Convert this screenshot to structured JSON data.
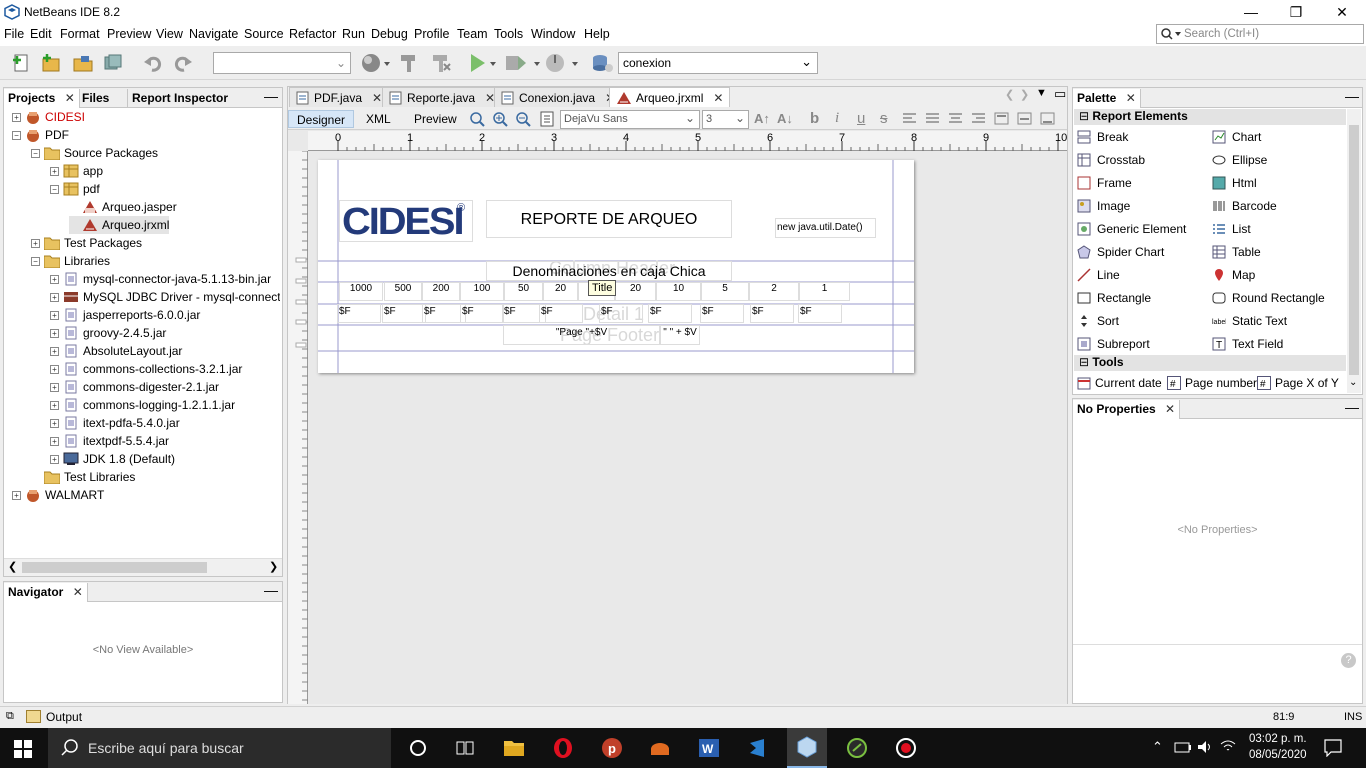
{
  "window": {
    "title": "NetBeans IDE 8.2",
    "min": "—",
    "restore": "❐",
    "close": "✕"
  },
  "menu": [
    "File",
    "Edit",
    "Format",
    "Preview",
    "View",
    "Navigate",
    "Source",
    "Refactor",
    "Run",
    "Debug",
    "Profile",
    "Team",
    "Tools",
    "Window",
    "Help"
  ],
  "search": {
    "placeholder": "Search (Ctrl+I)"
  },
  "toolbar": {
    "config_value": "",
    "connection_value": "conexion"
  },
  "projects_panel": {
    "tabs": [
      "Projects",
      "Files",
      "Report Inspector"
    ],
    "tree": [
      {
        "label": "CIDESI",
        "level": 0,
        "exp": "+",
        "icon": "project-icon",
        "red": true
      },
      {
        "label": "PDF",
        "level": 0,
        "exp": "-",
        "icon": "project-icon",
        "red": false
      },
      {
        "label": "Source Packages",
        "level": 1,
        "exp": "-",
        "icon": "folder-icon",
        "red": false
      },
      {
        "label": "app",
        "level": 2,
        "exp": "+",
        "icon": "package-icon",
        "red": false
      },
      {
        "label": "pdf",
        "level": 2,
        "exp": "-",
        "icon": "package-icon",
        "red": false
      },
      {
        "label": "Arqueo.jasper",
        "level": 3,
        "exp": "",
        "icon": "jasper-icon",
        "red": false
      },
      {
        "label": "Arqueo.jrxml",
        "level": 3,
        "exp": "",
        "icon": "jrxml-icon",
        "red": false
      },
      {
        "label": "Test Packages",
        "level": 1,
        "exp": "+",
        "icon": "folder-icon",
        "red": false
      },
      {
        "label": "Libraries",
        "level": 1,
        "exp": "-",
        "icon": "folder-icon",
        "red": false
      },
      {
        "label": "mysql-connector-java-5.1.13-bin.jar",
        "level": 2,
        "exp": "+",
        "icon": "jar-icon",
        "red": false
      },
      {
        "label": "MySQL JDBC Driver - mysql-connector-ja",
        "level": 2,
        "exp": "+",
        "icon": "driver-icon",
        "red": false
      },
      {
        "label": "jasperreports-6.0.0.jar",
        "level": 2,
        "exp": "+",
        "icon": "jar-icon",
        "red": false
      },
      {
        "label": "groovy-2.4.5.jar",
        "level": 2,
        "exp": "+",
        "icon": "jar-icon",
        "red": false
      },
      {
        "label": "AbsoluteLayout.jar",
        "level": 2,
        "exp": "+",
        "icon": "jar-icon",
        "red": false
      },
      {
        "label": "commons-collections-3.2.1.jar",
        "level": 2,
        "exp": "+",
        "icon": "jar-icon",
        "red": false
      },
      {
        "label": "commons-digester-2.1.jar",
        "level": 2,
        "exp": "+",
        "icon": "jar-icon",
        "red": false
      },
      {
        "label": "commons-logging-1.2.1.1.jar",
        "level": 2,
        "exp": "+",
        "icon": "jar-icon",
        "red": false
      },
      {
        "label": "itext-pdfa-5.4.0.jar",
        "level": 2,
        "exp": "+",
        "icon": "jar-icon",
        "red": false
      },
      {
        "label": "itextpdf-5.5.4.jar",
        "level": 2,
        "exp": "+",
        "icon": "jar-icon",
        "red": false
      },
      {
        "label": "JDK 1.8 (Default)",
        "level": 2,
        "exp": "+",
        "icon": "jdk-icon",
        "red": false
      },
      {
        "label": "Test Libraries",
        "level": 1,
        "exp": "",
        "icon": "folder-icon",
        "red": false
      },
      {
        "label": "WALMART",
        "level": 0,
        "exp": "+",
        "icon": "project-icon",
        "red": false
      }
    ]
  },
  "navigator": {
    "tab": "Navigator",
    "empty": "<No View Available>"
  },
  "editor": {
    "tabs": [
      {
        "label": "PDF.java",
        "icon": "java-icon",
        "active": false
      },
      {
        "label": "Reporte.java",
        "icon": "java-icon",
        "active": false
      },
      {
        "label": "Conexion.java",
        "icon": "java-icon",
        "active": false
      },
      {
        "label": "Arqueo.jrxml",
        "icon": "jrxml-icon",
        "active": true
      }
    ],
    "subtabs": [
      "Designer",
      "XML",
      "Preview"
    ],
    "font_value": "DejaVu Sans",
    "size_value": "3",
    "ruler": [
      "0",
      "1",
      "2",
      "3",
      "4",
      "5",
      "6",
      "7",
      "8",
      "9",
      "10"
    ]
  },
  "report": {
    "logo_text": "CIDESI",
    "logo_reg": "®",
    "title": "REPORTE DE ARQUEO",
    "date_expr": "new java.util.Date()",
    "subtitle": "Denominaciones en caja Chica",
    "tooltip": "Title",
    "denominations": [
      "1000",
      "500",
      "200",
      "100",
      "50",
      "20",
      "10",
      "20",
      "10",
      "5",
      "2",
      "1"
    ],
    "fields": [
      "$F",
      "$F",
      "$F",
      "$F",
      "$F",
      "$F",
      "$F",
      "$F",
      "$F",
      "$F",
      "$F"
    ],
    "band_labels": [
      "Column Header",
      "Detail 1",
      "Page Footer"
    ],
    "page_expr": "\"Page \"+$V",
    "page_expr2": "\" \" + $V"
  },
  "palette": {
    "tab": "Palette",
    "section1": "Report Elements",
    "items": [
      {
        "label": "Break",
        "icon": "break-icon"
      },
      {
        "label": "Chart",
        "icon": "chart-icon"
      },
      {
        "label": "Crosstab",
        "icon": "crosstab-icon"
      },
      {
        "label": "Ellipse",
        "icon": "ellipse-icon"
      },
      {
        "label": "Frame",
        "icon": "frame-icon"
      },
      {
        "label": "Html",
        "icon": "html-icon"
      },
      {
        "label": "Image",
        "icon": "image-icon"
      },
      {
        "label": "Barcode",
        "icon": "barcode-icon"
      },
      {
        "label": "Generic Element",
        "icon": "generic-icon"
      },
      {
        "label": "List",
        "icon": "list-icon"
      },
      {
        "label": "Spider Chart",
        "icon": "spider-icon"
      },
      {
        "label": "Table",
        "icon": "table-icon"
      },
      {
        "label": "Line",
        "icon": "line-icon"
      },
      {
        "label": "Map",
        "icon": "map-icon"
      },
      {
        "label": "Rectangle",
        "icon": "rectangle-icon"
      },
      {
        "label": "Round Rectangle",
        "icon": "round-rect-icon"
      },
      {
        "label": "Sort",
        "icon": "sort-icon"
      },
      {
        "label": "Static Text",
        "icon": "static-text-icon"
      },
      {
        "label": "Subreport",
        "icon": "subreport-icon"
      },
      {
        "label": "Text Field",
        "icon": "text-field-icon"
      }
    ],
    "section2": "Tools",
    "tools": [
      {
        "label": "Current date",
        "icon": "date-icon"
      },
      {
        "label": "Page number",
        "icon": "hash-icon"
      },
      {
        "label": "Page X of Y",
        "icon": "hash-icon"
      }
    ]
  },
  "properties": {
    "tab": "No Properties",
    "empty": "<No Properties>"
  },
  "statusbar": {
    "output": "Output",
    "position": "81:9",
    "mode": "INS"
  },
  "taskbar": {
    "search_placeholder": "Escribe aquí para buscar",
    "apps": [
      "cortana-icon",
      "task-view-icon",
      "file-explorer-icon",
      "opera-icon",
      "powerpoint-icon",
      "store-icon",
      "word-icon",
      "vscode-icon",
      "netbeans-icon",
      "app-icon",
      "record-icon"
    ],
    "time": "03:02 p. m.",
    "date": "08/05/2020"
  },
  "colors": {
    "accent": "#e8f1fa",
    "selected": "#d6e6f7",
    "error": "#cc0000"
  }
}
